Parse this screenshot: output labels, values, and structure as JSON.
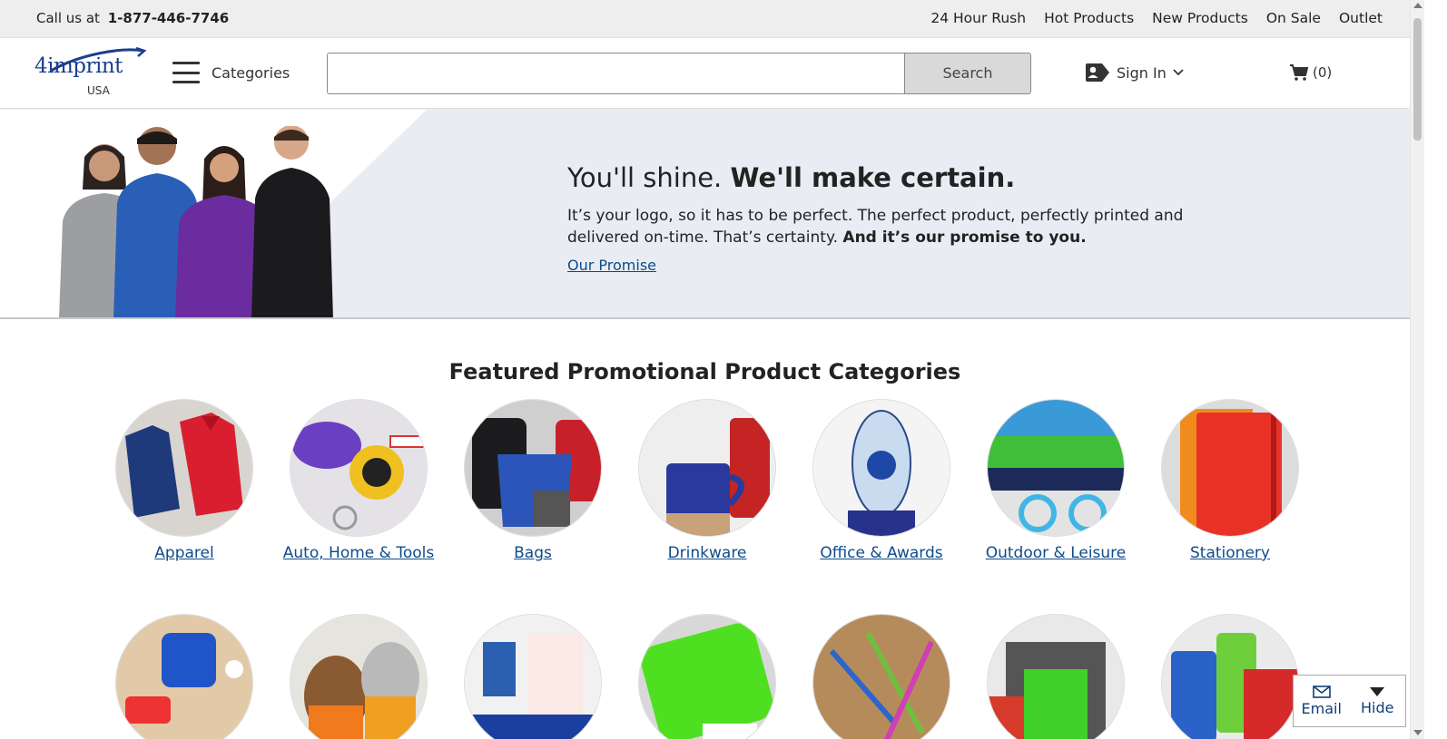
{
  "topbar": {
    "call_prefix": "Call us at",
    "phone": "1-877-446-7746",
    "links": [
      "24 Hour Rush",
      "Hot Products",
      "New Products",
      "On Sale",
      "Outlet"
    ]
  },
  "header": {
    "logo_text": "4imprint",
    "logo_region": "USA",
    "categories_label": "Categories",
    "search_placeholder": "",
    "search_button": "Search",
    "sign_in": "Sign In",
    "cart_count": "(0)"
  },
  "hero": {
    "headline_light": "You'll shine.",
    "headline_bold": "We'll make certain.",
    "body": "It’s your logo, so it has to be perfect. The perfect product, perfectly printed and delivered on-time. That’s certainty.",
    "body_bold": "And it’s our promise to you.",
    "link": "Our Promise"
  },
  "featured": {
    "title": "Featured Promotional Product Categories",
    "row1": [
      {
        "label": "Apparel",
        "icon": "apparel-image"
      },
      {
        "label": "Auto, Home & Tools",
        "icon": "auto-home-tools-image"
      },
      {
        "label": "Bags",
        "icon": "bags-image"
      },
      {
        "label": "Drinkware",
        "icon": "drinkware-image"
      },
      {
        "label": "Office & Awards",
        "icon": "office-awards-image"
      },
      {
        "label": "Outdoor & Leisure",
        "icon": "outdoor-leisure-image"
      },
      {
        "label": "Stationery",
        "icon": "stationery-image"
      }
    ]
  },
  "widget": {
    "email": "Email",
    "hide": "Hide"
  },
  "colors": {
    "link": "#0e4b8b",
    "hero_bg": "#e9edf3",
    "topbar_bg": "#eeeeee",
    "brand": "#1b3f8e"
  }
}
